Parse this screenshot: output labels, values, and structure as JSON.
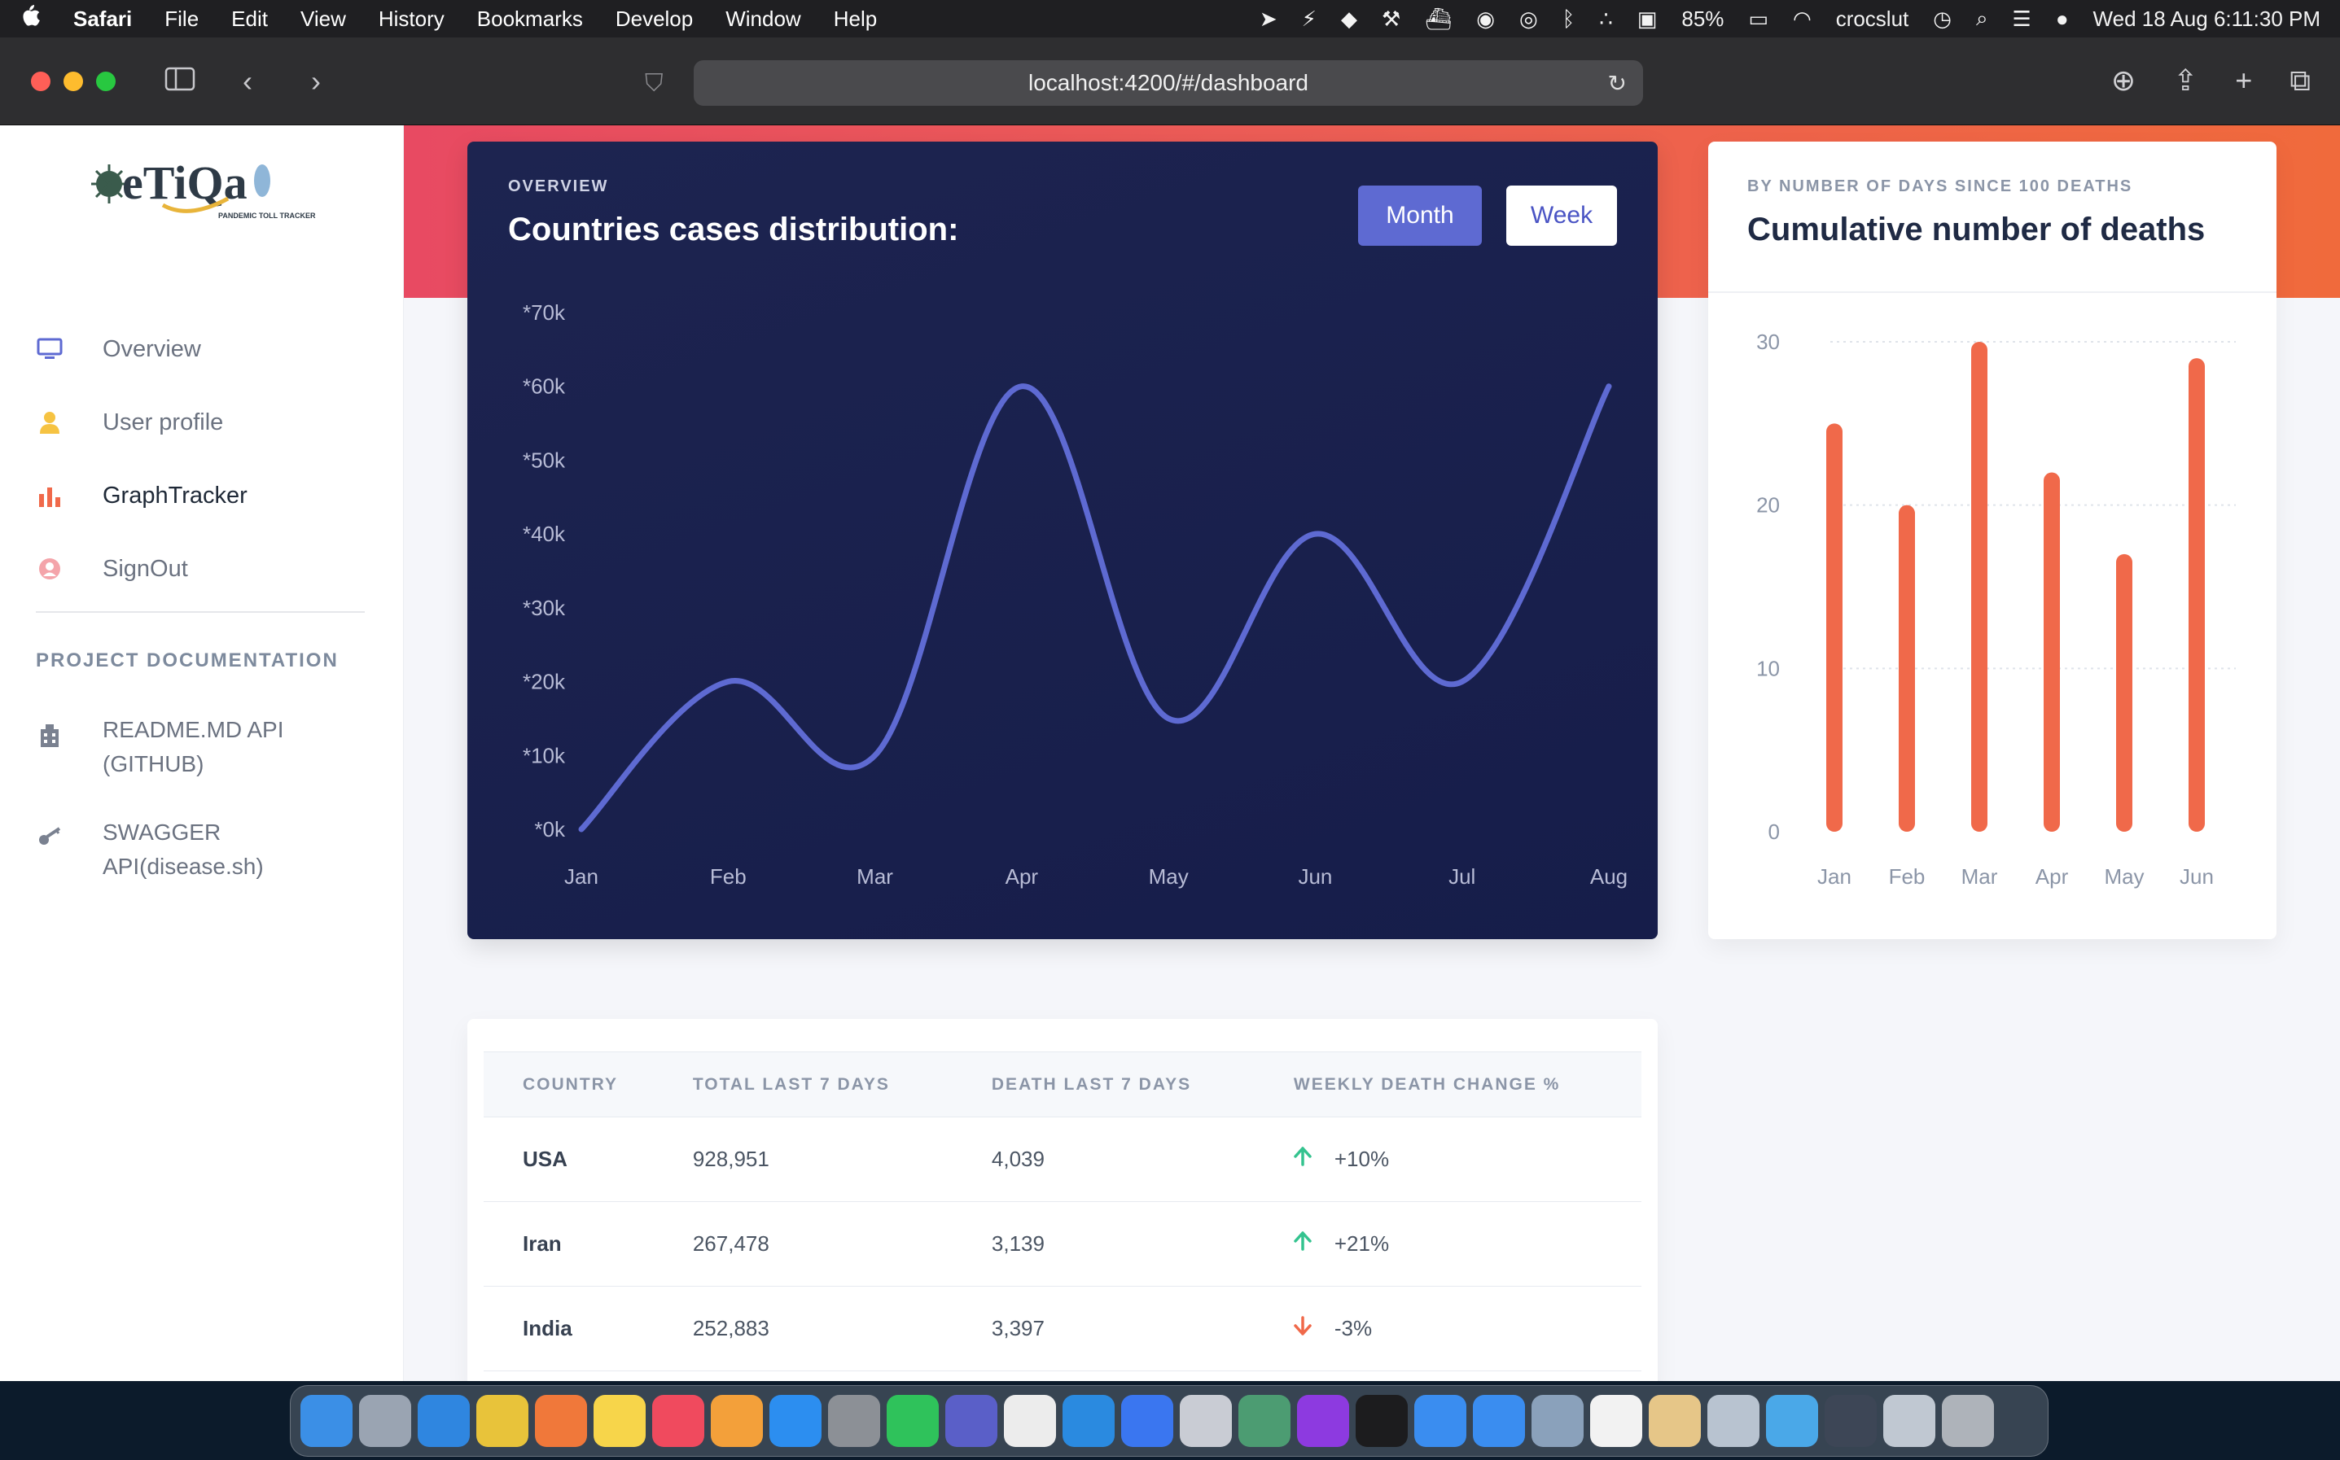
{
  "menubar": {
    "app": "Safari",
    "items": [
      "File",
      "Edit",
      "View",
      "History",
      "Bookmarks",
      "Develop",
      "Window",
      "Help"
    ],
    "battery": "85%",
    "user": "crocslut",
    "datetime": "Wed 18 Aug  6:11:30 PM"
  },
  "browser": {
    "url": "localhost:4200/#/dashboard"
  },
  "sidebar": {
    "nav": [
      {
        "label": "Overview",
        "icon": "monitor-icon"
      },
      {
        "label": "User profile",
        "icon": "user-icon"
      },
      {
        "label": "GraphTracker",
        "icon": "bar-chart-icon"
      },
      {
        "label": "SignOut",
        "icon": "sign-out-icon"
      }
    ],
    "doc_title": "PROJECT DOCUMENTATION",
    "docs": [
      {
        "line1": "README.MD API",
        "line2": "(GITHUB)",
        "icon": "building-icon"
      },
      {
        "line1": "SWAGGER",
        "line2": "API(disease.sh)",
        "icon": "key-icon"
      }
    ]
  },
  "overview_card": {
    "eyebrow": "OVERVIEW",
    "title": "Countries cases distribution:",
    "btn_month": "Month",
    "btn_week": "Week"
  },
  "deaths_card": {
    "eyebrow": "BY NUMBER OF DAYS SINCE 100 DEATHS",
    "title": "Cumulative number of deaths"
  },
  "table": {
    "headers": [
      "COUNTRY",
      "TOTAL LAST 7 DAYS",
      "DEATH LAST 7 DAYS",
      "WEEKLY DEATH CHANGE %"
    ],
    "rows": [
      {
        "country": "USA",
        "total": "928,951",
        "death": "4,039",
        "change": "+10%",
        "dir": "up"
      },
      {
        "country": "Iran",
        "total": "267,478",
        "death": "3,139",
        "change": "+21%",
        "dir": "up"
      },
      {
        "country": "India",
        "total": "252,883",
        "death": "3,397",
        "change": "-3%",
        "dir": "down"
      }
    ]
  },
  "colors": {
    "accent": "#5e6ad2",
    "line": "#5e6ad2",
    "bar": "#f0694a",
    "up": "#34c38f",
    "down": "#f0694a"
  },
  "chart_data": [
    {
      "type": "line",
      "x": [
        "Jan",
        "Feb",
        "Mar",
        "Apr",
        "May",
        "Jun",
        "Jul",
        "Aug"
      ],
      "values": [
        0,
        20,
        10,
        60,
        15,
        40,
        20,
        60
      ],
      "ytick_labels": [
        "*0k",
        "*10k",
        "*20k",
        "*30k",
        "*40k",
        "*50k",
        "*60k",
        "*70k"
      ],
      "ylim": [
        0,
        70
      ],
      "grid": false
    },
    {
      "type": "bar",
      "categories": [
        "Jan",
        "Feb",
        "Mar",
        "Apr",
        "May",
        "Jun"
      ],
      "values": [
        25,
        20,
        30,
        22,
        17,
        29
      ],
      "yticks": [
        0,
        10,
        20,
        30
      ],
      "ylim": [
        0,
        30
      ],
      "grid": true
    }
  ]
}
